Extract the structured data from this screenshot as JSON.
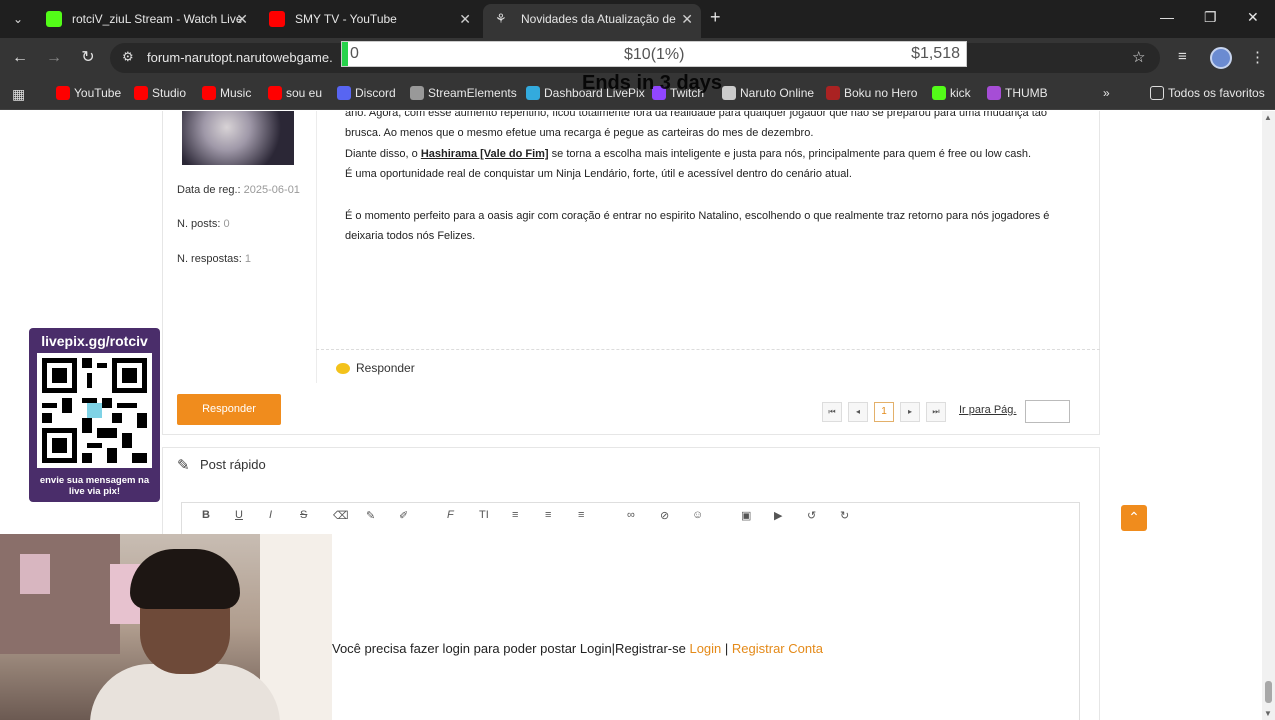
{
  "browser": {
    "tabs": [
      {
        "title": "rotciV_ziuL Stream - Watch Live",
        "color": "#53fc18"
      },
      {
        "title": "SMY TV - YouTube",
        "color": "#ff0000"
      },
      {
        "title": "Novidades da Atualização de",
        "color": "#dddddd"
      }
    ],
    "url": "forum-narutopt.narutowebgame.",
    "bookmarks": [
      {
        "label": "YouTube",
        "color": "#ff0000"
      },
      {
        "label": "Studio",
        "color": "#ff0000"
      },
      {
        "label": "Music",
        "color": "#ff0000"
      },
      {
        "label": "sou eu",
        "color": "#ff0000"
      },
      {
        "label": "Discord",
        "color": "#5865f2"
      },
      {
        "label": "StreamElements",
        "color": "#999999"
      },
      {
        "label": "Dashboard LivePix",
        "color": "#33aadd"
      },
      {
        "label": "Twitch",
        "color": "#9146ff"
      },
      {
        "label": "Naruto Online",
        "color": "#cccccc"
      },
      {
        "label": "Boku no Hero",
        "color": "#aa2222"
      },
      {
        "label": "kick",
        "color": "#53fc18"
      },
      {
        "label": "THUMB",
        "color": "#a64dd6"
      }
    ],
    "all_favorites": "Todos os favoritos"
  },
  "goal_bar": {
    "start": "0",
    "current": "$10(1%)",
    "target": "$1,518",
    "progress_pct": 1,
    "ends": "Ends in 3 days"
  },
  "post": {
    "meta": {
      "reg_label": "Data de reg.:",
      "reg_value": "2025-06-01",
      "posts_label": "N. posts:",
      "posts_value": "0",
      "replies_label": "N. respostas:",
      "replies_value": "1"
    },
    "line1": "ano. Agora, com esse aumento repentino, ficou totalmente fora da realidade para qualquer jogador que não se preparou para uma mudança tão",
    "line2": "brusca. Ao menos que o mesmo efetue uma recarga é pegue as carteiras do mes de dezembro.",
    "line3_pre": "Diante disso, o ",
    "line3_link": "Hashirama [Vale do Fim]",
    "line3_post": " se torna a escolha mais inteligente e justa para nós, principalmente para quem é free ou low cash.",
    "line4": "É uma oportunidade real de conquistar um Ninja Lendário, forte, útil e acessível dentro do cenário atual.",
    "line5": "É o momento perfeito para a oasis agir com coração é entrar no espirito Natalino, escolhendo o que realmente traz retorno para nós jogadores é",
    "line6": "deixaria todos nós Felizes.",
    "reply_link": "Responder"
  },
  "pager": {
    "button": "Responder",
    "current_page": "1",
    "goto_label": "Ir para Pág."
  },
  "quick_post": {
    "title": "Post rápido",
    "login_message": "Você precisa fazer login para poder postar Login|Registrar-se ",
    "login_link": "Login",
    "separator": " | ",
    "register_link": "Registrar Conta"
  },
  "overlay": {
    "qr_head": "livepix.gg/rotciv",
    "qr_foot_1": "envie sua mensagem na",
    "qr_foot_2": "live via pix!"
  }
}
